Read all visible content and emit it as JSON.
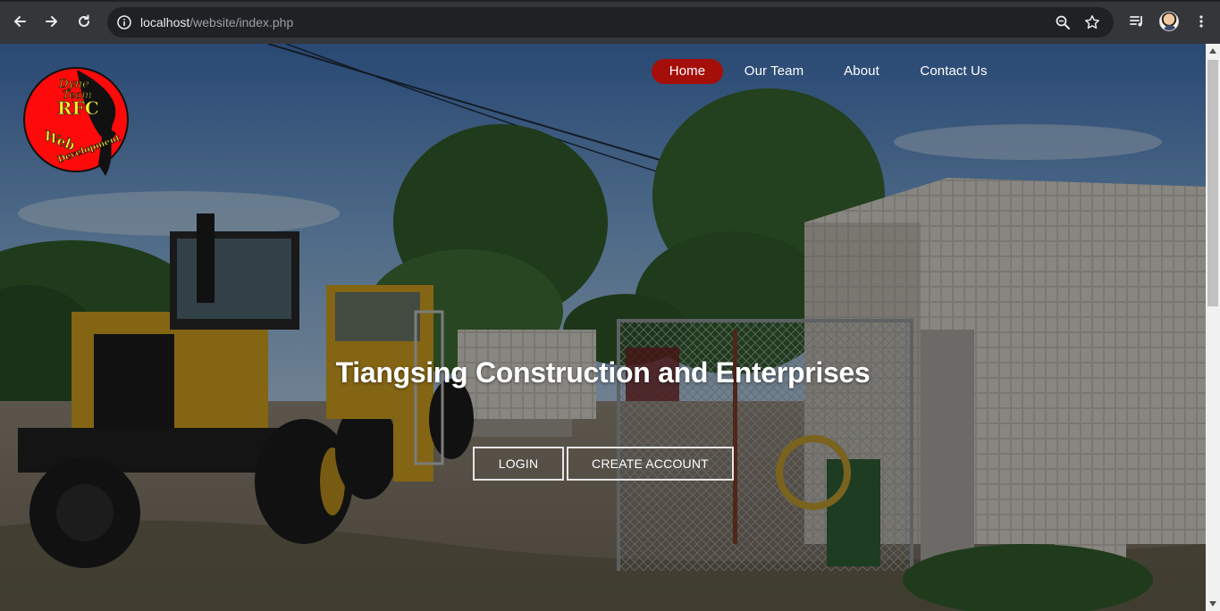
{
  "browser": {
    "url_host": "localhost",
    "url_path": "/website/index.php"
  },
  "logo": {
    "lines": [
      "Dyne",
      "Team",
      "RFC",
      "Web",
      "Development"
    ]
  },
  "nav": {
    "items": [
      {
        "label": "Home",
        "active": true
      },
      {
        "label": "Our Team",
        "active": false
      },
      {
        "label": "About",
        "active": false
      },
      {
        "label": "Contact Us",
        "active": false
      }
    ]
  },
  "hero": {
    "title": "Tiangsing Construction and Enterprises",
    "login_label": "LOGIN",
    "create_account_label": "CREATE ACCOUNT"
  },
  "colors": {
    "active_nav": "#a50f0a",
    "chrome_bg": "#35363a",
    "omnibox_bg": "#202124"
  }
}
